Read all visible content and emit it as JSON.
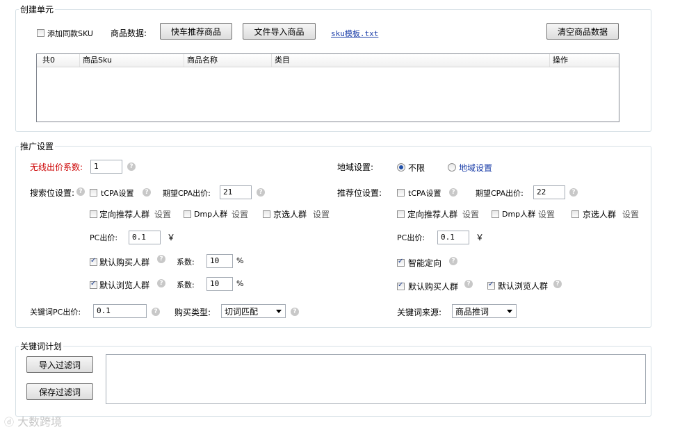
{
  "create_unit": {
    "legend": "创建单元",
    "add_same_sku_label": "添加同款SKU",
    "product_data_label": "商品数据:",
    "btn_kuaiche": "快车推荐商品",
    "btn_file_import": "文件导入商品",
    "sku_template_link": "sku模板.txt",
    "btn_clear": "清空商品数据",
    "table_headers": [
      "共0",
      "商品Sku",
      "商品名称",
      "类目",
      "操作"
    ]
  },
  "promo": {
    "legend": "推广设置",
    "wireless_bid_label": "无线出价系数:",
    "wireless_bid_value": "1",
    "region_label": "地域设置:",
    "region_unlimited": "不限",
    "region_setting": "地域设置",
    "search_pos_label": "搜索位设置:",
    "tcpa_label": "tCPA设置",
    "expected_cpa_label": "期望CPA出价:",
    "search_cpa_value": "21",
    "recommend_pos_label": "推荐位设置:",
    "recommend_cpa_value": "22",
    "directed_crowd": "定向推荐人群",
    "dmp_crowd": "Dmp人群",
    "jd_crowd": "京选人群",
    "setting": "设置",
    "pc_bid_label": "PC出价:",
    "pc_bid_value": "0.1",
    "currency": "￥",
    "default_buy_crowd": "默认购买人群",
    "default_browse_crowd": "默认浏览人群",
    "coef_label": "系数:",
    "coef_buy_value": "10",
    "coef_browse_value": "10",
    "percent": "%",
    "smart_direct": "智能定向",
    "kw_pc_bid_label": "关键词PC出价:",
    "kw_pc_bid_value": "0.1",
    "buy_type_label": "购买类型:",
    "buy_type_value": "切词匹配",
    "kw_source_label": "关键词来源:",
    "kw_source_value": "商品推词"
  },
  "kw_plan": {
    "legend": "关键词计划",
    "btn_import_filter": "导入过滤词",
    "btn_save_filter": "保存过滤词"
  },
  "watermark": "大数跨境",
  "colors": {
    "accent_red": "#cc0000",
    "link_blue": "#1a3da8",
    "border": "#d5dfe5"
  }
}
